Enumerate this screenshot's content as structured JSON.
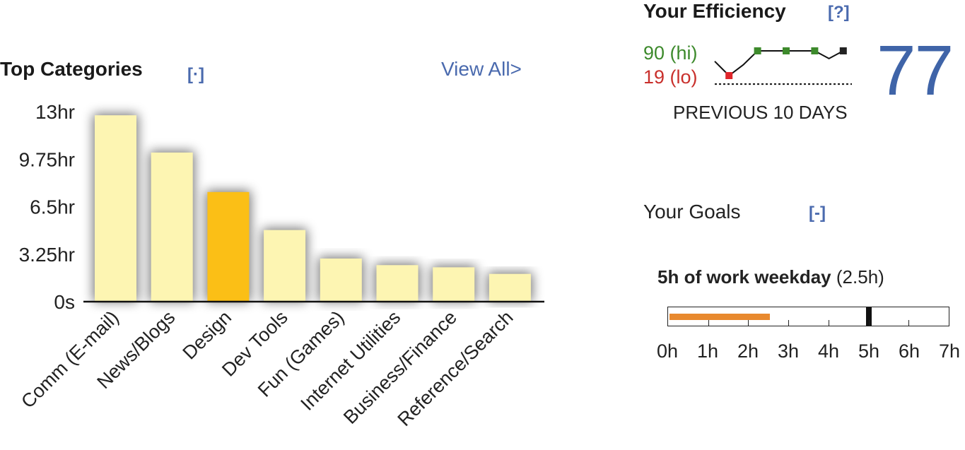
{
  "top_categories": {
    "title": "Top Categories",
    "toggle_label": "[·]",
    "view_all_label": "View All>"
  },
  "chart_data": {
    "type": "bar",
    "categories": [
      "Comm (E-mail)",
      "News/Blogs",
      "Design",
      "Dev Tools",
      "Fun (Games)",
      "Internet Utilities",
      "Business/Finance",
      "Reference/Search"
    ],
    "values": [
      12.75,
      10.2,
      7.5,
      4.9,
      2.95,
      2.5,
      2.35,
      1.9
    ],
    "units": "hr",
    "y_ticks": [
      "0s",
      "3.25hr",
      "6.5hr",
      "9.75hr",
      "13hr"
    ],
    "y_tick_values": [
      0,
      3.25,
      6.5,
      9.75,
      13
    ],
    "ylim": [
      0,
      13
    ],
    "highlighted_category": "Design",
    "colors": {
      "bar": "#fdf5b2",
      "highlight": "#fbbf16",
      "axis": "#111111"
    }
  },
  "efficiency": {
    "title": "Your Efficiency",
    "help_label": "[?]",
    "hi_label": "90 (hi)",
    "lo_label": "19 (lo)",
    "score": "77",
    "caption": "PREVIOUS 10 DAYS",
    "sparkline": {
      "values": [
        60,
        19,
        50,
        90,
        90,
        90,
        90,
        90,
        68,
        90
      ],
      "min": 19,
      "max": 90,
      "markers": [
        {
          "index": 1,
          "color": "#e0262b"
        },
        {
          "index": 3,
          "color": "#3d8a2c"
        },
        {
          "index": 5,
          "color": "#3d8a2c"
        },
        {
          "index": 7,
          "color": "#3d8a2c"
        },
        {
          "index": 9,
          "color": "#222222"
        }
      ]
    },
    "colors": {
      "hi": "#3d8a2c",
      "lo": "#c9302c",
      "score": "#3f64a8"
    }
  },
  "goals": {
    "title": "Your Goals",
    "toggle_label": "[-]",
    "goal_name": "5h of work weekday",
    "goal_progress_text": "(2.5h)",
    "progress_hours": 2.5,
    "target_hours": 5,
    "max_hours": 7,
    "axis_labels": [
      "0h",
      "1h",
      "2h",
      "3h",
      "4h",
      "5h",
      "6h",
      "7h"
    ],
    "colors": {
      "fill": "#e8892e",
      "marker": "#111111"
    }
  }
}
